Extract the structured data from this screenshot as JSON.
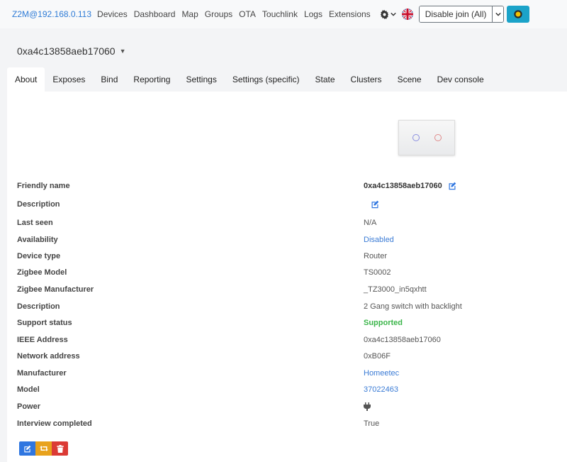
{
  "navbar": {
    "brand": "Z2M@192.168.0.113",
    "links": [
      "Devices",
      "Dashboard",
      "Map",
      "Groups",
      "OTA",
      "Touchlink",
      "Logs",
      "Extensions"
    ],
    "join_button": "Disable join (All)",
    "icons": {
      "settings": "gear-icon",
      "language": "uk-flag-icon",
      "theme": "sun-icon"
    }
  },
  "device": {
    "title": "0xa4c13858aeb17060",
    "image_icon": "two-gang-switch-image"
  },
  "tabs": [
    "About",
    "Exposes",
    "Bind",
    "Reporting",
    "Settings",
    "Settings (specific)",
    "State",
    "Clusters",
    "Scene",
    "Dev console"
  ],
  "active_tab": "About",
  "about": {
    "friendly_name_label": "Friendly name",
    "friendly_name": "0xa4c13858aeb17060",
    "description_label": "Description",
    "description": "",
    "last_seen_label": "Last seen",
    "last_seen": "N/A",
    "availability_label": "Availability",
    "availability": "Disabled",
    "device_type_label": "Device type",
    "device_type": "Router",
    "zigbee_model_label": "Zigbee Model",
    "zigbee_model": "TS0002",
    "zigbee_manufacturer_label": "Zigbee Manufacturer",
    "zigbee_manufacturer": "_TZ3000_in5qxhtt",
    "description2_label": "Description",
    "description2": "2 Gang switch with backlight",
    "support_status_label": "Support status",
    "support_status": "Supported",
    "ieee_label": "IEEE Address",
    "ieee": "0xa4c13858aeb17060",
    "network_label": "Network address",
    "network": "0xB06F",
    "manufacturer_label": "Manufacturer",
    "manufacturer": "Homeetec",
    "model_label": "Model",
    "model": "37022463",
    "power_label": "Power",
    "power_icon": "plug-icon",
    "interview_label": "Interview completed",
    "interview": "True"
  },
  "colors": {
    "brand": "#2e7bd6",
    "link": "#3a7bd5",
    "supported": "#3bb54a",
    "edit_button": "#2f76e0",
    "reconfigure_button": "#e8a21c",
    "delete_button": "#db3a35"
  }
}
